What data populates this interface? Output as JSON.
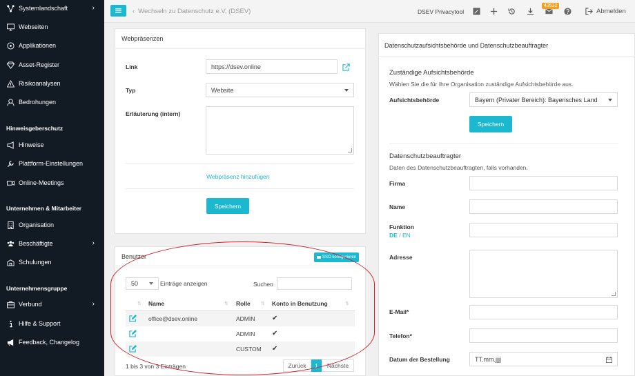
{
  "sidebar": {
    "items": [
      {
        "label": "Systemlandschaft",
        "icon": "network-icon",
        "chevron": "›"
      },
      {
        "label": "Webseiten",
        "icon": "monitor-icon"
      },
      {
        "label": "Applikationen",
        "icon": "compass-icon"
      },
      {
        "label": "Asset-Register",
        "icon": "diamond-icon"
      },
      {
        "label": "Risikoanalysen",
        "icon": "warning-icon"
      },
      {
        "label": "Bedrohungen",
        "icon": "hacker-icon"
      }
    ],
    "section1": "Hinweisgeberschutz",
    "items2": [
      {
        "label": "Hinweise",
        "icon": "megaphone-icon"
      },
      {
        "label": "Plattform-Einstellungen",
        "icon": "wrench-icon"
      },
      {
        "label": "Online-Meetings",
        "icon": "video-icon"
      }
    ],
    "section2": "Unternehmen & Mitarbeiter",
    "items3": [
      {
        "label": "Organisation",
        "icon": "building-icon"
      },
      {
        "label": "Beschäftigte",
        "icon": "users-icon",
        "chevron": "›"
      },
      {
        "label": "Schulungen",
        "icon": "school-icon"
      }
    ],
    "section3": "Unternehmensgruppe",
    "items4": [
      {
        "label": "Verbund",
        "icon": "briefcase-icon",
        "chevron": "›"
      },
      {
        "label": "Hilfe & Support",
        "icon": "info-icon"
      },
      {
        "label": "Feedback, Changelog",
        "icon": "bullhorn-icon"
      }
    ]
  },
  "topbar": {
    "menu_icon": "hamburger-icon",
    "breadcrumb_arrow": "‹",
    "breadcrumb": "Wechseln zu Datenschutz e.V. (DSEV)",
    "tool_title": "DSEV Privacytool",
    "badge": "43532",
    "logout": "Abmelden"
  },
  "webpraesenzen": {
    "title": "Webpräsenzen",
    "link_label": "Link",
    "link_value": "https://dsev.online",
    "typ_label": "Typ",
    "typ_value": "Website",
    "erl_label": "Erläuterung (intern)",
    "add_link": "Webpräsenz hinzufügen",
    "save": "Speichern"
  },
  "benutzer": {
    "title": "Benutzer",
    "sso_button": "SSO konfigurieren",
    "page_size": "50",
    "entries_label": "Einträge anzeigen",
    "search_label": "Suchen",
    "columns": [
      "Name",
      "Rolle",
      "Konto in Benutzung"
    ],
    "rows": [
      {
        "name": "office@dsev.online",
        "role": "ADMIN",
        "active": "✔"
      },
      {
        "name": "",
        "role": "ADMIN",
        "active": "✔"
      },
      {
        "name": "",
        "role": "CUSTOM",
        "active": "✔"
      }
    ],
    "info": "1 bis 3 von 3 Einträgen",
    "prev": "Zurück",
    "page": "1",
    "next": "Nächste"
  },
  "dsb": {
    "title": "Datenschutzaufsichtsbehörde und Datenschutzbeauftragter",
    "authority_heading": "Zuständige Aufsichtsbehörde",
    "authority_desc": "Wählen Sie die für Ihre Organisation zuständige Aufsichtsbehörde aus.",
    "authority_label": "Aufsichtsbehörde",
    "authority_value": "Bayern (Privater Bereich): Bayerisches Land",
    "save": "Speichern",
    "officer_heading": "Datenschutzbeauftragter",
    "officer_desc": "Daten des Datenschutzbeauftragten, falls vorhanden.",
    "firma": "Firma",
    "name": "Name",
    "funktion": "Funktion",
    "lang_de": "DE",
    "lang_sep": "/",
    "lang_en": "EN",
    "adresse": "Adresse",
    "email": "E-Mail*",
    "telefon": "Telefon*",
    "datum": "Datum der Bestellung",
    "datum_placeholder": "TT.mm.jjjj"
  },
  "colors": {
    "accent": "#1bb8d0",
    "sidebar": "#121a24",
    "highlight": "#d0202a"
  }
}
